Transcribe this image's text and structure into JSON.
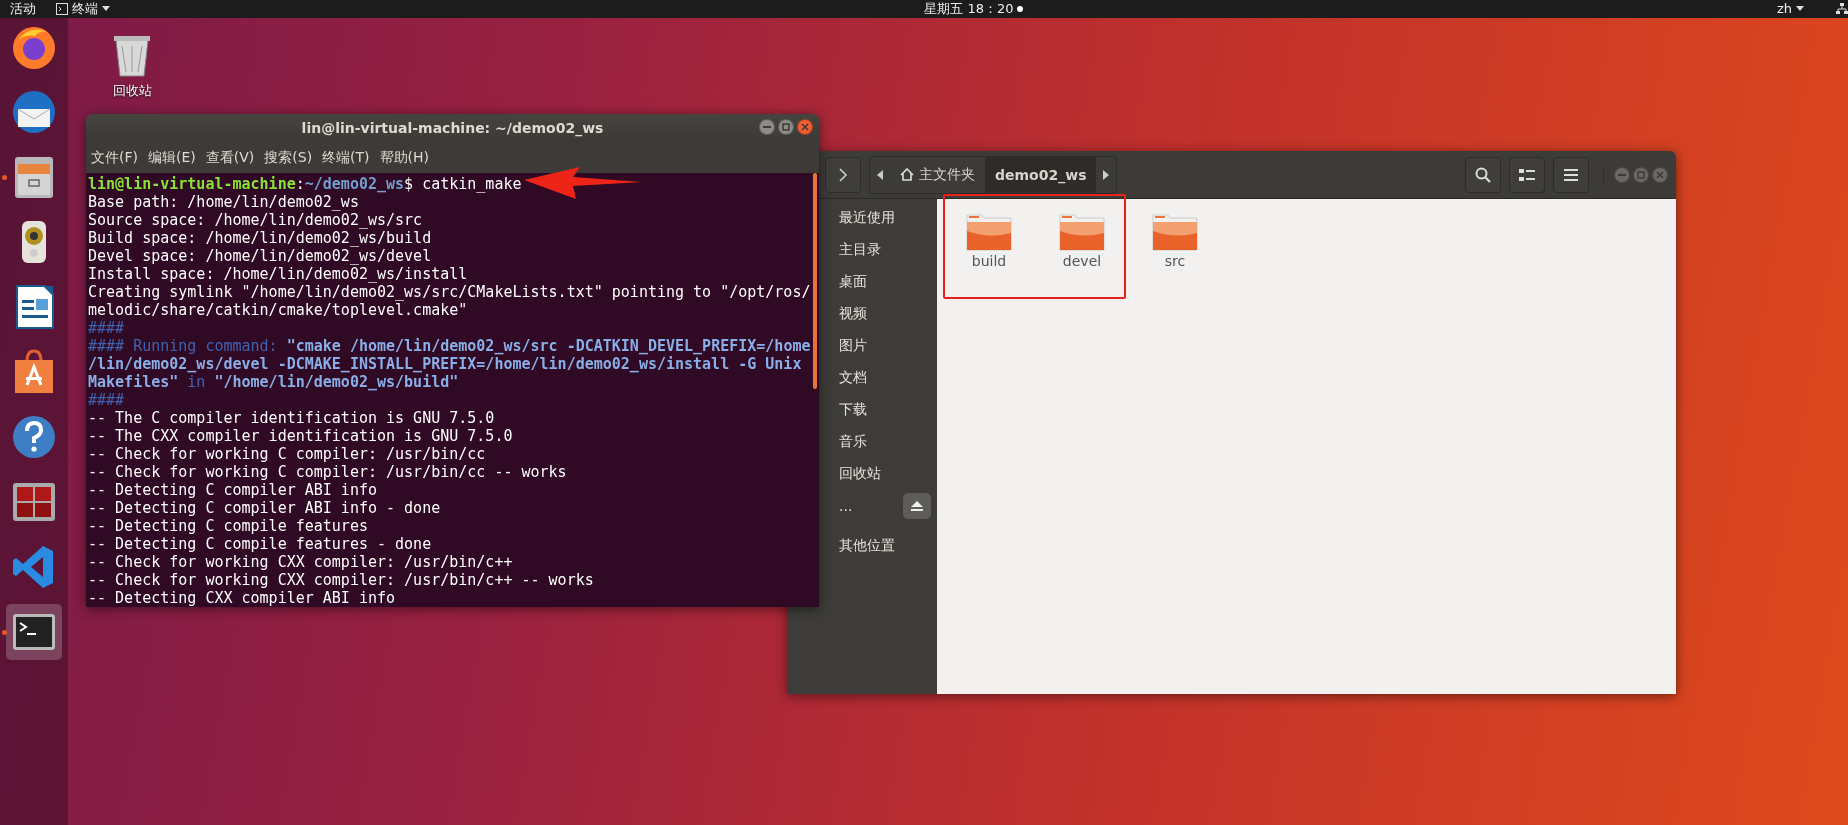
{
  "top_bar": {
    "activities": "活动",
    "app_menu": "终端",
    "clock": "星期五 18：20",
    "notification": true,
    "input_method": "zh"
  },
  "dock": [
    {
      "kind": "firefox",
      "running": false,
      "selected": false
    },
    {
      "kind": "thunderbird",
      "running": false,
      "selected": false
    },
    {
      "kind": "files",
      "running": true,
      "selected": false
    },
    {
      "kind": "rhythmbox",
      "running": false,
      "selected": false
    },
    {
      "kind": "writer",
      "running": false,
      "selected": false
    },
    {
      "kind": "software",
      "running": false,
      "selected": false
    },
    {
      "kind": "help",
      "running": false,
      "selected": false
    },
    {
      "kind": "monitor",
      "running": false,
      "selected": false
    },
    {
      "kind": "vscode",
      "running": false,
      "selected": false
    },
    {
      "kind": "terminal",
      "running": true,
      "selected": true
    }
  ],
  "desktop": {
    "icons": [
      {
        "label": "回收站"
      }
    ]
  },
  "terminal": {
    "title": "lin@lin-virtual-machine: ~/demo02_ws",
    "menu": [
      "文件(F)",
      "编辑(E)",
      "查看(V)",
      "搜索(S)",
      "终端(T)",
      "帮助(H)"
    ],
    "lines": [
      {
        "kind": "prompt",
        "parts": [
          {
            "kind": "user",
            "text": "lin@lin-virtual-machine"
          },
          {
            "kind": "plain",
            "text": ":"
          },
          {
            "kind": "path",
            "text": "~/demo02_ws"
          },
          {
            "kind": "plain",
            "text": "$ catkin_make"
          }
        ]
      },
      {
        "kind": "plain",
        "text": "Base path: /home/lin/demo02_ws"
      },
      {
        "kind": "plain",
        "text": "Source space: /home/lin/demo02_ws/src"
      },
      {
        "kind": "plain",
        "text": "Build space: /home/lin/demo02_ws/build"
      },
      {
        "kind": "plain",
        "text": "Devel space: /home/lin/demo02_ws/devel"
      },
      {
        "kind": "plain",
        "text": "Install space: /home/lin/demo02_ws/install"
      },
      {
        "kind": "plain",
        "text": "Creating symlink \"/home/lin/demo02_ws/src/CMakeLists.txt\" pointing to \"/opt/ros/"
      },
      {
        "kind": "plain",
        "text": "melodic/share/catkin/cmake/toplevel.cmake\""
      },
      {
        "kind": "info",
        "text": "####"
      },
      {
        "kind": "info",
        "text": "#### Running command: **\"cmake /home/lin/demo02_ws/src -DCATKIN_DEVEL_PREFIX=/home**"
      },
      {
        "kind": "info",
        "text": "**/lin/demo02_ws/devel -DCMAKE_INSTALL_PREFIX=/home/lin/demo02_ws/install -G Unix**"
      },
      {
        "kind": "info",
        "text": "**Makefiles\"** in **\"/home/lin/demo02_ws/build\"**"
      },
      {
        "kind": "info",
        "text": "####"
      },
      {
        "kind": "plain",
        "text": "-- The C compiler identification is GNU 7.5.0"
      },
      {
        "kind": "plain",
        "text": "-- The CXX compiler identification is GNU 7.5.0"
      },
      {
        "kind": "plain",
        "text": "-- Check for working C compiler: /usr/bin/cc"
      },
      {
        "kind": "plain",
        "text": "-- Check for working C compiler: /usr/bin/cc -- works"
      },
      {
        "kind": "plain",
        "text": "-- Detecting C compiler ABI info"
      },
      {
        "kind": "plain",
        "text": "-- Detecting C compiler ABI info - done"
      },
      {
        "kind": "plain",
        "text": "-- Detecting C compile features"
      },
      {
        "kind": "plain",
        "text": "-- Detecting C compile features - done"
      },
      {
        "kind": "plain",
        "text": "-- Check for working CXX compiler: /usr/bin/c++"
      },
      {
        "kind": "plain",
        "text": "-- Check for working CXX compiler: /usr/bin/c++ -- works"
      },
      {
        "kind": "plain",
        "text": "-- Detecting CXX compiler ABI info"
      }
    ]
  },
  "file_manager": {
    "path_bar": [
      {
        "kind": "home",
        "label": "主文件夹",
        "selected": false
      },
      {
        "kind": "folder",
        "label": "demo02_ws",
        "selected": true
      }
    ],
    "sidebar": [
      {
        "kind": "place",
        "label": "最近使用"
      },
      {
        "kind": "place",
        "label": "主目录"
      },
      {
        "kind": "place",
        "label": "桌面"
      },
      {
        "kind": "place",
        "label": "视频"
      },
      {
        "kind": "place",
        "label": "图片"
      },
      {
        "kind": "place",
        "label": "文档"
      },
      {
        "kind": "place",
        "label": "下载"
      },
      {
        "kind": "place",
        "label": "音乐"
      },
      {
        "kind": "place",
        "label": "回收站"
      },
      {
        "kind": "mount",
        "label": "..."
      },
      {
        "kind": "other",
        "label": "其他位置"
      }
    ],
    "files": [
      {
        "kind": "folder",
        "name": "build"
      },
      {
        "kind": "folder",
        "name": "devel"
      },
      {
        "kind": "folder",
        "name": "src"
      }
    ]
  }
}
